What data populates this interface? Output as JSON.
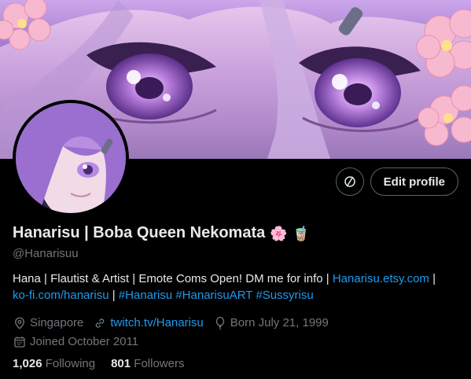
{
  "profile": {
    "display_name": "Hanarisu | Boba Queen Nekomata",
    "name_emoji_1": "🌸",
    "name_emoji_2": "🧋",
    "handle": "@Hanarisuu",
    "bio": {
      "text_1": "Hana | Flautist & Artist | Emote Coms Open! DM me for info | ",
      "link_1": "Hanarisu.etsy.com",
      "text_2": " | ",
      "link_2": "ko-fi.com/hanarisu",
      "text_3": " | ",
      "tag_1": "#Hanarisu",
      "tag_2": "#HanarisuART",
      "tag_3": "#Sussyrisu"
    },
    "location": "Singapore",
    "website": "twitch.tv/Hanarisu",
    "birthday": "Born July 21, 1999",
    "joined": "Joined October 2011",
    "following_count": "1,026",
    "following_label": "Following",
    "followers_count": "801",
    "followers_label": "Followers"
  },
  "actions": {
    "edit_profile_label": "Edit profile",
    "verify_icon": "verified-circle-slash-icon"
  },
  "colors": {
    "background": "#000000",
    "text_primary": "#e7e9ea",
    "text_secondary": "#71767b",
    "link": "#1d9bf0",
    "border": "#536471"
  }
}
